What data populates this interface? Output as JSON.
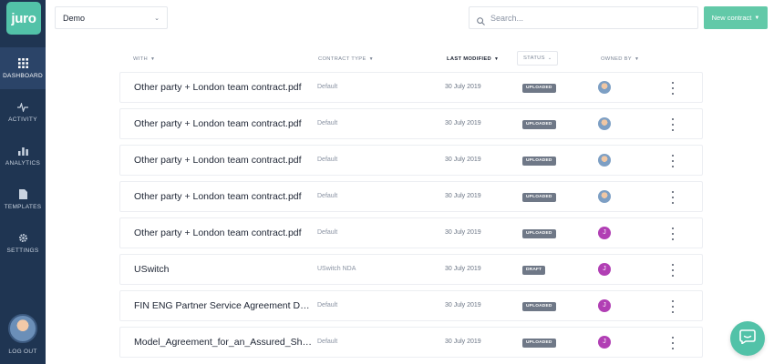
{
  "brand": {
    "logo": "juro",
    "accent": "#52c2a8",
    "sidebar_bg": "#1f3552"
  },
  "sidebar": {
    "items": [
      {
        "label": "DASHBOARD",
        "icon": "grid-icon",
        "active": true
      },
      {
        "label": "ACTIVITY",
        "icon": "pulse-icon",
        "active": false
      },
      {
        "label": "ANALYTICS",
        "icon": "bar-chart-icon",
        "active": false
      },
      {
        "label": "TEMPLATES",
        "icon": "document-icon",
        "active": false
      },
      {
        "label": "SETTINGS",
        "icon": "gear-icon",
        "active": false
      }
    ],
    "logout": "LOG OUT"
  },
  "topbar": {
    "org": "Demo",
    "search_placeholder": "Search...",
    "new_contract": "New contract"
  },
  "table": {
    "columns": {
      "with": "WITH",
      "contract_type": "CONTRACT TYPE",
      "last_modified": "LAST MODIFIED",
      "status": "STATUS",
      "owned_by": "OWNED BY"
    },
    "rows": [
      {
        "name": "Other party + London team contract.pdf",
        "type": "Default",
        "modified": "30 July 2019",
        "status": "UPLOADED",
        "owner": "photo",
        "owner_initial": ""
      },
      {
        "name": "Other party + London team contract.pdf",
        "type": "Default",
        "modified": "30 July 2019",
        "status": "UPLOADED",
        "owner": "photo",
        "owner_initial": ""
      },
      {
        "name": "Other party + London team contract.pdf",
        "type": "Default",
        "modified": "30 July 2019",
        "status": "UPLOADED",
        "owner": "photo",
        "owner_initial": ""
      },
      {
        "name": "Other party + London team contract.pdf",
        "type": "Default",
        "modified": "30 July 2019",
        "status": "UPLOADED",
        "owner": "photo",
        "owner_initial": ""
      },
      {
        "name": "Other party + London team contract.pdf",
        "type": "Default",
        "modified": "30 July 2019",
        "status": "UPLOADED",
        "owner": "initial",
        "owner_initial": "J"
      },
      {
        "name": "USwitch",
        "type": "USwitch NDA",
        "modified": "30 July 2019",
        "status": "DRAFT",
        "owner": "initial",
        "owner_initial": "J"
      },
      {
        "name": "FIN ENG Partner Service Agreement DE...",
        "type": "Default",
        "modified": "30 July 2019",
        "status": "UPLOADED",
        "owner": "initial",
        "owner_initial": "J"
      },
      {
        "name": "Model_Agreement_for_an_Assured_Sho...",
        "type": "Default",
        "modified": "30 July 2019",
        "status": "UPLOADED",
        "owner": "initial",
        "owner_initial": "J"
      }
    ]
  },
  "chat": {
    "icon": "chat-bubble-icon"
  }
}
